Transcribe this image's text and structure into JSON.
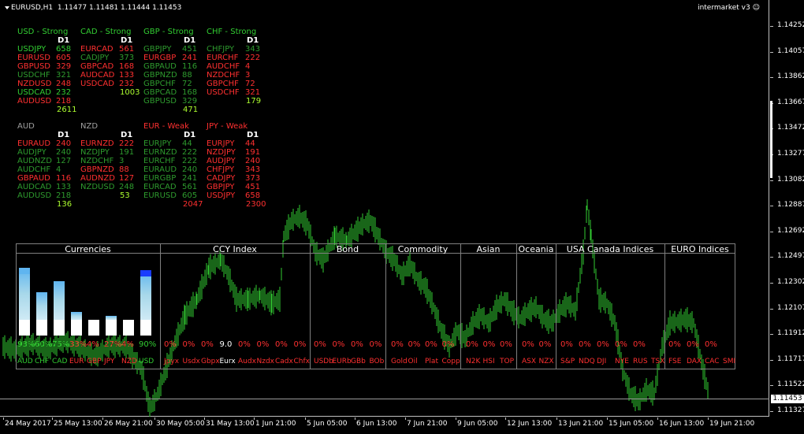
{
  "header": {
    "symbol_tf": "EURUSD,H1",
    "ohlc": "1.11477 1.11481 1.11444 1.11453"
  },
  "indicator": {
    "name": "intermarket v3"
  },
  "price_axis": {
    "ticks": [
      "1.14252",
      "1.14057",
      "1.13862",
      "1.13667",
      "1.13472",
      "1.13277",
      "1.13082",
      "1.12887",
      "1.12692",
      "1.12497",
      "1.12302",
      "1.12107",
      "1.11912",
      "1.11717",
      "1.11522",
      "1.11327"
    ],
    "current": "1.11453"
  },
  "time_axis": {
    "ticks": [
      "24 May 2017",
      "25 May 13:00",
      "26 May 21:00",
      "30 May 05:00",
      "31 May 13:00",
      "1 Jun 21:00",
      "5 Jun 05:00",
      "6 Jun 13:00",
      "7 Jun 21:00",
      "9 Jun 05:00",
      "12 Jun 13:00",
      "13 Jun 21:00",
      "15 Jun 05:00",
      "16 Jun 13:00",
      "19 Jun 21:00"
    ]
  },
  "tables": [
    {
      "title": "USD - Strong",
      "title_color": "g",
      "tf": "D1",
      "rows": [
        [
          "USDJPY",
          "658",
          "g"
        ],
        [
          "EURUSD",
          "605",
          "r"
        ],
        [
          "GBPUSD",
          "329",
          "r"
        ],
        [
          "USDCHF",
          "321",
          "dg"
        ],
        [
          "NZDUSD",
          "248",
          "r"
        ],
        [
          "USDCAD",
          "232",
          "g"
        ],
        [
          "AUDUSD",
          "218",
          "r"
        ]
      ],
      "total": "2611"
    },
    {
      "title": "CAD - Strong",
      "title_color": "g",
      "tf": "D1",
      "rows": [
        [
          "EURCAD",
          "561",
          "r"
        ],
        [
          "CADJPY",
          "373",
          "dg"
        ],
        [
          "GBPCAD",
          "168",
          "r"
        ],
        [
          "AUDCAD",
          "133",
          "r"
        ],
        [
          "USDCAD",
          "232",
          "r"
        ]
      ],
      "total": "1003"
    },
    {
      "title": "GBP - Strong",
      "title_color": "g",
      "tf": "D1",
      "rows": [
        [
          "GBPJPY",
          "451",
          "dg"
        ],
        [
          "EURGBP",
          "241",
          "r"
        ],
        [
          "GBPAUD",
          "116",
          "dg"
        ],
        [
          "GBPNZD",
          "88",
          "dg"
        ],
        [
          "GBPCHF",
          "72",
          "dg"
        ],
        [
          "GBPCAD",
          "168",
          "dg"
        ],
        [
          "GBPUSD",
          "329",
          "dg"
        ]
      ],
      "total": "471"
    },
    {
      "title": "CHF - Strong",
      "title_color": "g",
      "tf": "D1",
      "rows": [
        [
          "CHFJPY",
          "343",
          "dg"
        ],
        [
          "EURCHF",
          "222",
          "r"
        ],
        [
          "AUDCHF",
          "4",
          "r"
        ],
        [
          "NZDCHF",
          "3",
          "r"
        ],
        [
          "GBPCHF",
          "72",
          "r"
        ],
        [
          "USDCHF",
          "321",
          "r"
        ]
      ],
      "total": "179"
    },
    {
      "title": "AUD",
      "title_color": "gr",
      "tf": "D1",
      "rows": [
        [
          "EURAUD",
          "240",
          "r"
        ],
        [
          "AUDJPY",
          "240",
          "dg"
        ],
        [
          "AUDNZD",
          "127",
          "dg"
        ],
        [
          "AUDCHF",
          "4",
          "dg"
        ],
        [
          "GBPAUD",
          "116",
          "r"
        ],
        [
          "AUDCAD",
          "133",
          "dg"
        ],
        [
          "AUDUSD",
          "218",
          "dg"
        ]
      ],
      "total": "136"
    },
    {
      "title": "NZD",
      "title_color": "gr",
      "tf": "D1",
      "rows": [
        [
          "EURNZD",
          "222",
          "r"
        ],
        [
          "NZDJPY",
          "191",
          "dg"
        ],
        [
          "NZDCHF",
          "3",
          "dg"
        ],
        [
          "GBPNZD",
          "88",
          "r"
        ],
        [
          "AUDNZD",
          "127",
          "r"
        ],
        [
          "NZDUSD",
          "248",
          "dg"
        ]
      ],
      "total": "53"
    },
    {
      "title": "EUR - Weak",
      "title_color": "r",
      "tf": "D1",
      "rows": [
        [
          "EURJPY",
          "44",
          "dg"
        ],
        [
          "EURNZD",
          "222",
          "dg"
        ],
        [
          "EURCHF",
          "222",
          "dg"
        ],
        [
          "EURAUD",
          "240",
          "dg"
        ],
        [
          "EURGBP",
          "241",
          "dg"
        ],
        [
          "EURCAD",
          "561",
          "dg"
        ],
        [
          "EURUSD",
          "605",
          "dg"
        ]
      ],
      "total": "2047"
    },
    {
      "title": "JPY - Weak",
      "title_color": "r",
      "tf": "D1",
      "rows": [
        [
          "EURJPY",
          "44",
          "r"
        ],
        [
          "NZDJPY",
          "191",
          "r"
        ],
        [
          "AUDJPY",
          "240",
          "r"
        ],
        [
          "CHFJPY",
          "343",
          "r"
        ],
        [
          "CADJPY",
          "373",
          "r"
        ],
        [
          "GBPJPY",
          "451",
          "r"
        ],
        [
          "USDJPY",
          "658",
          "r"
        ]
      ],
      "total": "2300"
    }
  ],
  "panel": {
    "headers": [
      "Currencies",
      "CCY Index",
      "Bond",
      "Commodity",
      "Asian",
      "Oceania",
      "USA Canada Indices",
      "EURO Indices"
    ],
    "currency_pcts": [
      {
        "t": "93%",
        "c": "g"
      },
      {
        "t": "60%",
        "c": "g"
      },
      {
        "t": "75%",
        "c": "g"
      },
      {
        "t": "33%",
        "c": "r"
      },
      {
        "t": "4%",
        "c": "r"
      },
      {
        "t": "27%",
        "c": "r"
      },
      {
        "t": "4%",
        "c": "r"
      },
      {
        "t": "90%",
        "c": "g"
      }
    ],
    "currency_labels": [
      {
        "t": "AUD",
        "c": "g"
      },
      {
        "t": "CHF",
        "c": "g"
      },
      {
        "t": "CAD",
        "c": "g"
      },
      {
        "t": "EUR",
        "c": "r"
      },
      {
        "t": "GBP",
        "c": "r"
      },
      {
        "t": "JPY",
        "c": "r"
      },
      {
        "t": "NZD",
        "c": "r"
      },
      {
        "t": "USD",
        "c": "g"
      }
    ],
    "ccy_pcts": [
      "0%",
      "0%",
      "0%",
      "9.0",
      "0%",
      "0%",
      "0%",
      "0%"
    ],
    "ccy_labels": [
      "Jpyx",
      "Usdx",
      "Gbpx",
      "Eurx",
      "Audx",
      "Nzdx",
      "Cadx",
      "Chfx"
    ],
    "bond_pcts": [
      "0%",
      "0%",
      "0%",
      "0%"
    ],
    "bond_labels": [
      "USDb",
      "EURb",
      "GBb",
      "BOb"
    ],
    "comm_pcts": [
      "0%",
      "0%",
      "0%",
      "0%"
    ],
    "comm_labels": [
      "Gold",
      "Oil",
      "Plat",
      "Copp"
    ],
    "asian_pcts": [
      "0%",
      "0%",
      "0%"
    ],
    "asian_labels": [
      "N2K",
      "HSI",
      "TOP"
    ],
    "oce_pcts": [
      "0%",
      "0%"
    ],
    "oce_labels": [
      "ASX",
      "NZX"
    ],
    "usa_pcts": [
      "0%",
      "0%",
      "0%",
      "0%",
      "0%"
    ],
    "usa_labels": [
      "S&P",
      "NDQ",
      "DJI",
      "NYE",
      "RUS",
      "TSX"
    ],
    "euro_pcts": [
      "0%",
      "0%",
      "0%"
    ],
    "euro_labels": [
      "FSE",
      "DAX",
      "CAC",
      "SMI"
    ]
  },
  "colors": {
    "g": "#32cd32",
    "dg": "#2e9b2e",
    "r": "#ff3030",
    "lg": "#adff2f",
    "bar_light": "#a8d8ea",
    "bar_mid": "#5fb5f0",
    "bar_dark": "#1a3cff",
    "candle": "#32cd32"
  }
}
